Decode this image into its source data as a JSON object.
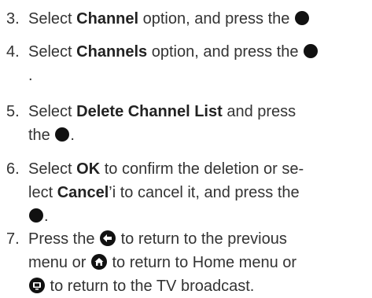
{
  "steps": [
    {
      "num": "3.",
      "pre": "Select ",
      "bold": "Channel",
      "post": " option, and press the "
    },
    {
      "num": "4.",
      "pre": "Select ",
      "bold": "Channels",
      "post": " option, and press the ",
      "trail": "."
    },
    {
      "num": "5.",
      "pre": "Select ",
      "bold": "Delete Channel List",
      "post": " and press",
      "line2": "the ",
      "end": "."
    },
    {
      "num": "6.",
      "pre": "Select ",
      "bold": "OK",
      "post": " to confirm the deletion or se-",
      "line2_pre": "lect ",
      "line2_bold": "Cancel",
      "line2_post": "’i to cancel it, and press the",
      "end": "."
    },
    {
      "num": "7.",
      "pre": "Press the ",
      "post": " to return to the previous",
      "line2_pre": "menu or ",
      "line2_post": " to return to Home menu or",
      "line3_post": " to return to the TV broadcast."
    }
  ],
  "icons": {
    "ok": "ok-button-icon",
    "back": "back-arrow-icon",
    "home": "home-icon",
    "tv": "tv-broadcast-icon"
  }
}
